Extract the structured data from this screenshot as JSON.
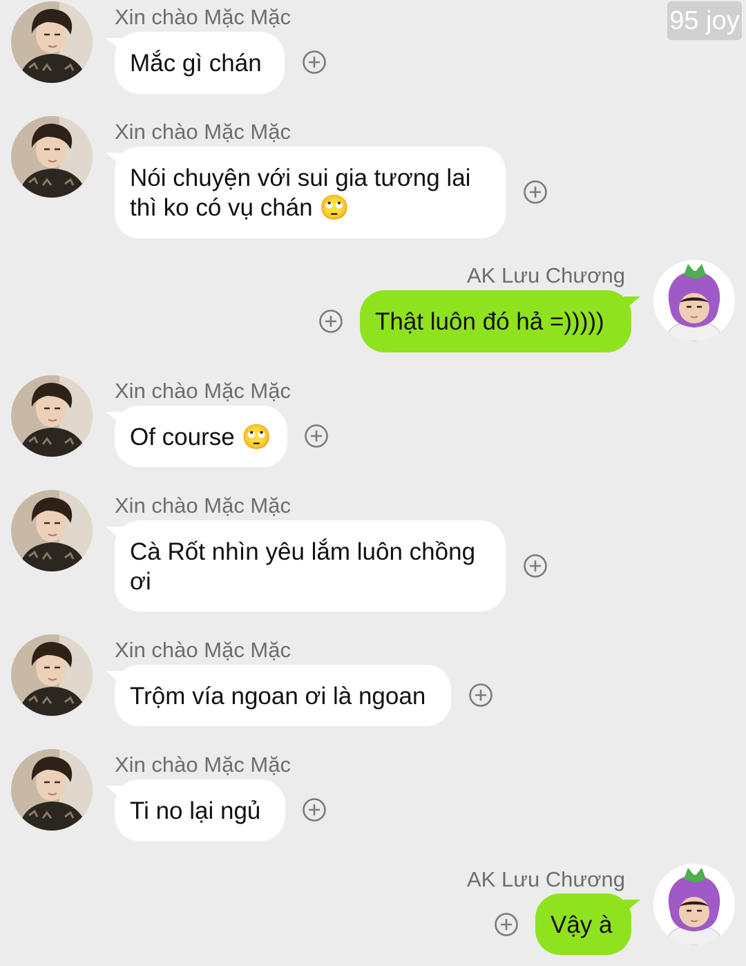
{
  "watermark": "95 joy",
  "senders": {
    "other": "Xin chào Mặc Mặc",
    "self": "AK Lưu Chương"
  },
  "messages": [
    {
      "from": "other",
      "text": "Mắc gì chán"
    },
    {
      "from": "other",
      "text": "Nói chuyện với sui gia tương lai thì ko có vụ chán 🙄"
    },
    {
      "from": "self",
      "text": "Thật luôn đó hả =)))))"
    },
    {
      "from": "other",
      "text": "Of course 🙄"
    },
    {
      "from": "other",
      "text": "Cà Rốt nhìn yêu lắm luôn chồng ơi"
    },
    {
      "from": "other",
      "text": "Trộm vía ngoan ơi là ngoan"
    },
    {
      "from": "other",
      "text": "Ti no lại ngủ"
    },
    {
      "from": "self",
      "text": "Vậy à"
    }
  ],
  "colors": {
    "background": "#ececec",
    "incoming_bubble": "#ffffff",
    "outgoing_bubble": "#8fe21e",
    "name_text": "#6d6d6d",
    "plus_icon": "#7a7a7a"
  },
  "icons": {
    "reaction": "plus-circle-icon",
    "other_avatar": "avatar-photo",
    "self_avatar": "eggplant-hat-avatar"
  }
}
